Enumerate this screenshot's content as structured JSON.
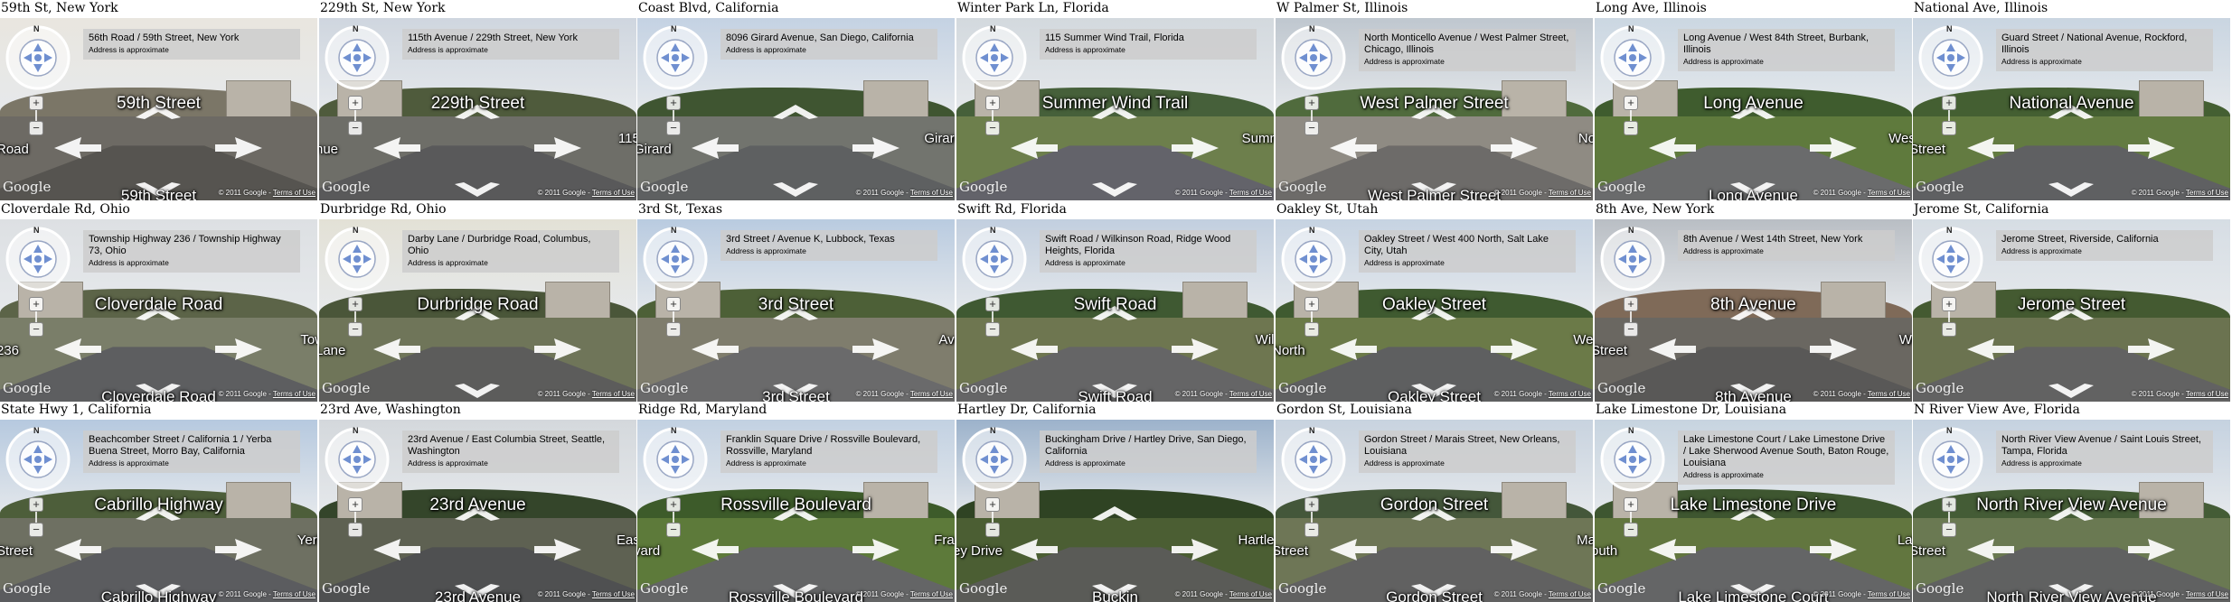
{
  "colors": {
    "addr_box": "#cccccc",
    "arrow": "#ffffff",
    "label": "#ffffff",
    "title_text": "#000000"
  },
  "icons": {
    "compass": "compass-icon",
    "pegman": "pegman-icon",
    "zoom_in": "zoom-in-icon",
    "zoom_out": "zoom-out-icon",
    "nav_arrow": "navigation-arrow-icon"
  },
  "common": {
    "address_note": "Address is approximate",
    "copyright": "© 2011 Google",
    "terms": "Terms of Use",
    "logo": "Google",
    "compass_n": "N",
    "zoom_in": "+",
    "zoom_out": "−"
  },
  "panels": [
    {
      "title": "59th St, New York",
      "address": "56th Road / 59th Street, New York",
      "street_main": "59th Street",
      "street_left": "Road",
      "street_right": "",
      "street_bottom": "59th Street",
      "scene": {
        "sky": "#e9e6df",
        "ground": "#6d6a64",
        "road": "#565450",
        "trees": "#7b7667"
      }
    },
    {
      "title": "229th St, New York",
      "address": "115th Avenue / 229th Street, New York",
      "street_main": "229th Street",
      "street_left": "nue",
      "street_right": "115t",
      "street_bottom": "",
      "scene": {
        "sky": "#cfd6df",
        "ground": "#6e6e68",
        "road": "#59595a",
        "trees": "#4f5b3c"
      }
    },
    {
      "title": "Coast Blvd, California",
      "address": "8096 Girard Avenue, San Diego, California",
      "street_main": "",
      "street_left": "Girard",
      "street_right": "Girard",
      "street_bottom": "",
      "scene": {
        "sky": "#c4d2e3",
        "ground": "#72746e",
        "road": "#5e6061",
        "trees": "#3f5531"
      }
    },
    {
      "title": "Winter Park Ln, Florida",
      "address": "115 Summer Wind Trail, Florida",
      "street_main": "Summer Wind Trail",
      "street_left": "",
      "street_right": "Summ",
      "street_bottom": "",
      "scene": {
        "sky": "#d3d9de",
        "ground": "#6d7f4c",
        "road": "#63636a",
        "trees": "#46603a"
      }
    },
    {
      "title": "W Palmer St, Illinois",
      "address": "North Monticello Avenue / West Palmer Street, Chicago, Illinois",
      "street_main": "West Palmer Street",
      "street_left": "",
      "street_right": "Nor",
      "street_bottom": "West Palmer Street",
      "scene": {
        "sky": "#bfc7cf",
        "ground": "#8f8b83",
        "road": "#6d6b69",
        "trees": "#506b3d"
      }
    },
    {
      "title": "Long Ave, Illinois",
      "address": "Long Avenue / West 84th Street, Burbank, Illinois",
      "street_main": "Long Avenue",
      "street_left": "",
      "street_right": "West",
      "street_bottom": "Long Avenue",
      "scene": {
        "sky": "#cbd7e2",
        "ground": "#5f7a3d",
        "road": "#6a6b6c",
        "trees": "#3f5c2e"
      }
    },
    {
      "title": "National Ave, Illinois",
      "address": "Guard Street / National Avenue, Rockford, Illinois",
      "street_main": "National Avenue",
      "street_left": "Street",
      "street_right": "",
      "street_bottom": "",
      "scene": {
        "sky": "#c9d5e1",
        "ground": "#637b41",
        "road": "#5f6062",
        "trees": "#445f32"
      }
    },
    {
      "title": "Cloverdale Rd, Ohio",
      "address": "Township Highway 236 / Township Highway 73, Ohio",
      "street_main": "Cloverdale Road",
      "street_left": "236",
      "street_right": "Tow",
      "street_bottom": "Cloverdale Road",
      "scene": {
        "sky": "#dde0e3",
        "ground": "#7a7e69",
        "road": "#5d5e60",
        "trees": "#5c6448"
      }
    },
    {
      "title": "Durbridge Rd, Ohio",
      "address": "Darby Lane / Durbridge Road, Columbus, Ohio",
      "street_main": "Durbridge Road",
      "street_left": "Lane",
      "street_right": "",
      "street_bottom": "",
      "scene": {
        "sky": "#e3e1d6",
        "ground": "#6f7559",
        "road": "#5c5c5b",
        "trees": "#4a5639"
      }
    },
    {
      "title": "3rd St, Texas",
      "address": "3rd Street / Avenue K, Lubbock, Texas",
      "street_main": "3rd Street",
      "street_left": "",
      "street_right": "Ave",
      "street_bottom": "3rd Street",
      "scene": {
        "sky": "#b9cbe0",
        "ground": "#7f7d6d",
        "road": "#6a6a6b",
        "trees": "#4d6037"
      }
    },
    {
      "title": "Swift Rd, Florida",
      "address": "Swift Road / Wilkinson Road, Ridge Wood Heights, Florida",
      "street_main": "Swift Road",
      "street_left": "",
      "street_right": "Wilk",
      "street_bottom": "Swift Road",
      "scene": {
        "sky": "#c2cfdf",
        "ground": "#6e7650",
        "road": "#656566",
        "trees": "#3f5932"
      }
    },
    {
      "title": "Oakley St, Utah",
      "address": "Oakley Street / West 400 North, Salt Lake City, Utah",
      "street_main": "Oakley Street",
      "street_left": "North",
      "street_right": "Wes",
      "street_bottom": "Oakley Street",
      "scene": {
        "sky": "#c6d3e2",
        "ground": "#6b7a48",
        "road": "#5e5f60",
        "trees": "#3f5a30"
      }
    },
    {
      "title": "8th Ave, New York",
      "address": "8th Avenue / West 14th Street, New York",
      "street_main": "8th Avenue",
      "street_left": "Street",
      "street_right": "We",
      "street_bottom": "8th Avenue",
      "scene": {
        "sky": "#b9bec4",
        "ground": "#6a6761",
        "road": "#595857",
        "trees": "#7f6a58"
      }
    },
    {
      "title": "Jerome St, California",
      "address": "Jerome Street, Riverside, California",
      "street_main": "Jerome Street",
      "street_left": "",
      "street_right": "",
      "street_bottom": "",
      "scene": {
        "sky": "#d6dde4",
        "ground": "#6b7350",
        "road": "#626262",
        "trees": "#445a31"
      }
    },
    {
      "title": "State Hwy 1, California",
      "address": "Beachcomber Street / California 1 / Yerba Buena Street, Morro Bay, California",
      "street_main": "Cabrillo Highway",
      "street_left": "Street",
      "street_right": "Yerb",
      "street_bottom": "Cabrillo Highway",
      "scene": {
        "sky": "#b6c9df",
        "ground": "#6e7062",
        "road": "#5b5c5f",
        "trees": "#4d5e3a"
      }
    },
    {
      "title": "23rd Ave, Washington",
      "address": "23rd Avenue / East Columbia Street, Seattle, Washington",
      "street_main": "23rd Avenue",
      "street_left": "",
      "street_right": "East",
      "street_bottom": "23rd Avenue",
      "scene": {
        "sky": "#d4d8dc",
        "ground": "#5e6152",
        "road": "#4f5051",
        "trees": "#34452a"
      }
    },
    {
      "title": "Ridge Rd, Maryland",
      "address": "Franklin Square Drive / Rossville Boulevard, Rossville, Maryland",
      "street_main": "Rossville Boulevard",
      "street_left": "vard",
      "street_right": "Fran",
      "street_bottom": "Rossville Boulevard",
      "scene": {
        "sky": "#c2d1e2",
        "ground": "#5d7a3a",
        "road": "#646566",
        "trees": "#3d5b2a"
      }
    },
    {
      "title": "Hartley Dr, California",
      "address": "Buckingham Drive / Hartley Drive, San Diego, California",
      "street_main": "",
      "street_left": "ey Drive",
      "street_right": "Hartley",
      "street_bottom": "Buckin",
      "scene": {
        "sky": "#9cb2cb",
        "ground": "#4b5e33",
        "road": "#5a5b57",
        "trees": "#2f4323"
      }
    },
    {
      "title": "Gordon St, Louisiana",
      "address": "Gordon Street / Marais Street, New Orleans, Louisiana",
      "street_main": "Gordon Street",
      "street_left": "Street",
      "street_right": "Mar",
      "street_bottom": "Gordon Street",
      "scene": {
        "sky": "#c8d3df",
        "ground": "#6e7656",
        "road": "#616161",
        "trees": "#44573a"
      }
    },
    {
      "title": "Lake Limestone Dr, Louisiana",
      "address": "Lake Limestone Court / Lake Limestone Drive / Lake Sherwood Avenue South, Baton Rouge, Louisiana",
      "street_main": "Lake Limestone Drive",
      "street_left": "outh",
      "street_right": "Lak",
      "street_bottom": "Lake Limestone Court",
      "scene": {
        "sky": "#c7d4e0",
        "ground": "#62763f",
        "road": "#646566",
        "trees": "#3e5630"
      }
    },
    {
      "title": "N River View Ave, Florida",
      "address": "North River View Avenue / Saint Louis Street, Tampa, Florida",
      "street_main": "North River View Avenue",
      "street_left": "Street",
      "street_right": "",
      "street_bottom": "North River View Avenue",
      "scene": {
        "sky": "#c5d2e0",
        "ground": "#6a7952",
        "road": "#606161",
        "trees": "#445c36"
      }
    }
  ]
}
